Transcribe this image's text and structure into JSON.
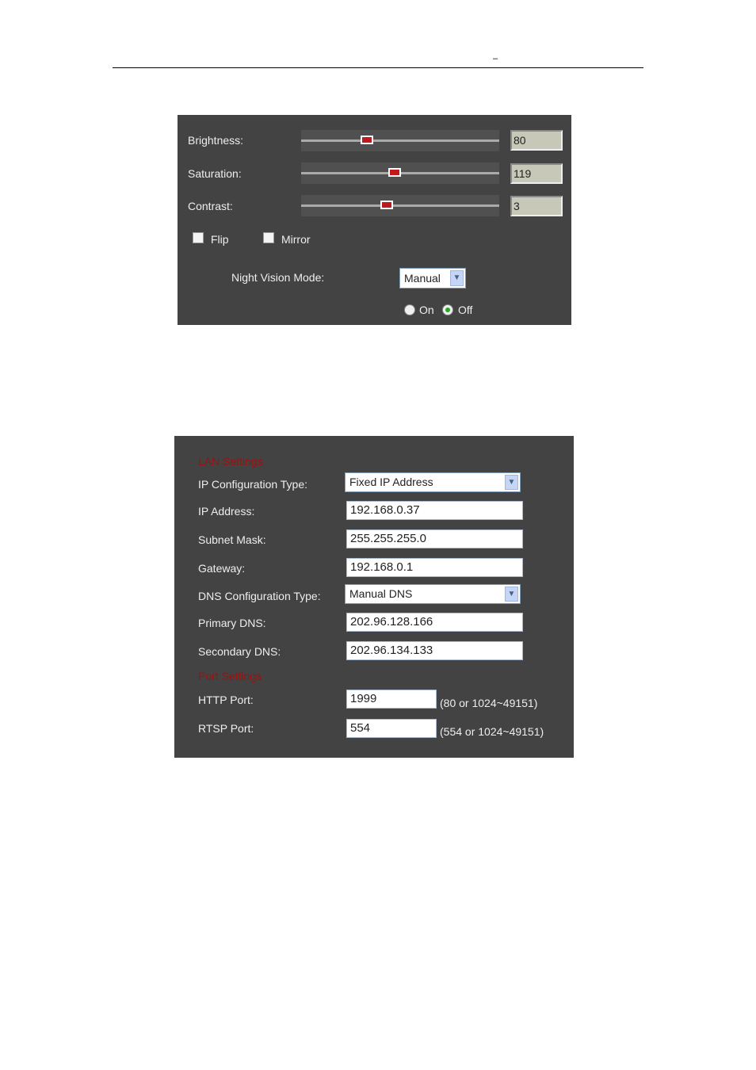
{
  "header": {
    "mark": "–"
  },
  "image_panel": {
    "brightness": {
      "label": "Brightness:",
      "value": "80",
      "level": 0.33
    },
    "saturation": {
      "label": "Saturation:",
      "value": "119",
      "level": 0.47
    },
    "contrast": {
      "label": "Contrast:",
      "value": "3",
      "level": 0.43
    },
    "flip": {
      "label": "Flip",
      "checked": false
    },
    "mirror": {
      "label": "Mirror",
      "checked": false
    },
    "night_vision": {
      "label": "Night Vision Mode:",
      "selected": "Manual",
      "on_label": "On",
      "off_label": "Off",
      "state": "Off"
    }
  },
  "network_panel": {
    "lan_title": "LAN Settings",
    "ip_config": {
      "label": "IP Configuration Type:",
      "selected": "Fixed IP Address"
    },
    "ip_address": {
      "label": "IP Address:",
      "value": "192.168.0.37"
    },
    "subnet": {
      "label": "Subnet Mask:",
      "value": "255.255.255.0"
    },
    "gateway": {
      "label": "Gateway:",
      "value": "192.168.0.1"
    },
    "dns_config": {
      "label": "DNS Configuration Type:",
      "selected": "Manual DNS"
    },
    "primary_dns": {
      "label": "Primary DNS:",
      "value": "202.96.128.166"
    },
    "secondary_dns": {
      "label": "Secondary DNS:",
      "value": "202.96.134.133"
    },
    "port_title": "Port Settings",
    "http_port": {
      "label": "HTTP Port:",
      "value": "1999",
      "hint": "(80 or 1024~49151)"
    },
    "rtsp_port": {
      "label": "RTSP Port:",
      "value": "554",
      "hint": "(554 or 1024~49151)"
    }
  },
  "colors": {
    "panel": "#434343",
    "section_title": "#a30e0e",
    "slider_thumb": "#c0191c"
  }
}
